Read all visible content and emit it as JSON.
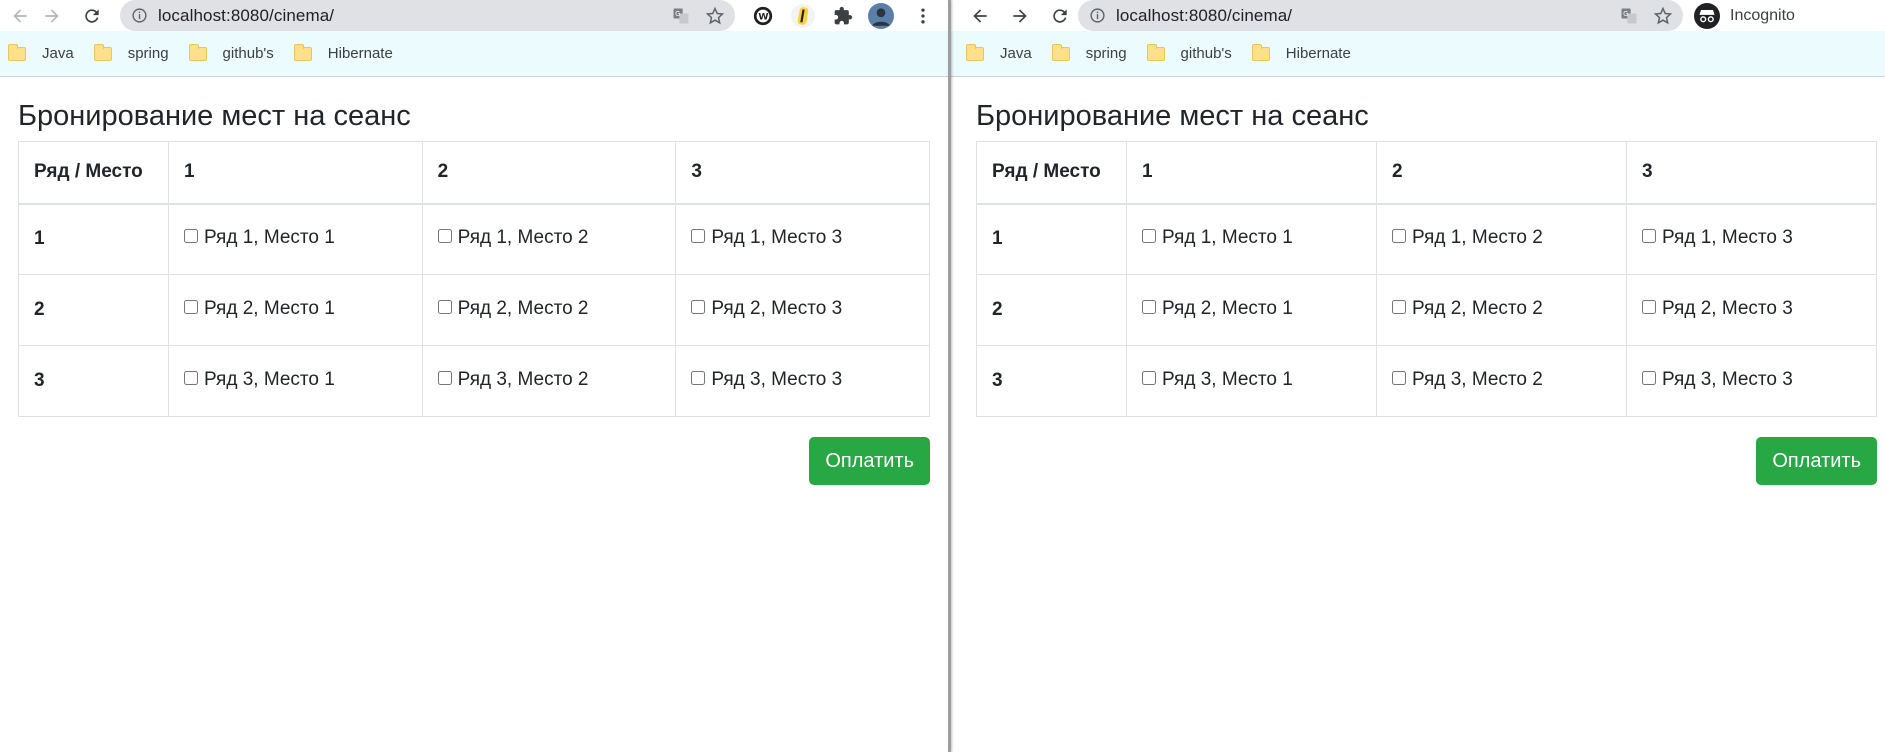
{
  "browser_left": {
    "url": "localhost:8080/cinema/",
    "bookmarks": [
      "Java",
      "spring",
      "github's",
      "Hibernate"
    ]
  },
  "browser_right": {
    "url": "localhost:8080/cinema/",
    "incognito_label": "Incognito",
    "bookmarks": [
      "Java",
      "spring",
      "github's",
      "Hibernate"
    ]
  },
  "page": {
    "title": "Бронирование мест на сеанс",
    "header": [
      "Ряд / Место",
      "1",
      "2",
      "3"
    ],
    "rows": [
      {
        "row": "1",
        "seats": [
          "Ряд 1, Место 1",
          "Ряд 1, Место 2",
          "Ряд 1, Место 3"
        ]
      },
      {
        "row": "2",
        "seats": [
          "Ряд 2, Место 1",
          "Ряд 2, Место 2",
          "Ряд 2, Место 3"
        ]
      },
      {
        "row": "3",
        "seats": [
          "Ряд 3, Место 1",
          "Ряд 3, Место 2",
          "Ряд 3, Место 3"
        ]
      }
    ],
    "pay_button": "Оплатить"
  },
  "colors": {
    "pay_button": "#28a745",
    "bookmarks_bar": "#ecfbfd",
    "folder": "#fce08a"
  },
  "icons": [
    "back-icon",
    "forward-icon",
    "reload-icon",
    "info-icon",
    "translate-icon",
    "star-icon",
    "extension-icon",
    "puzzle-icon",
    "avatar",
    "menu-icon",
    "incognito-icon",
    "folder-icon"
  ]
}
